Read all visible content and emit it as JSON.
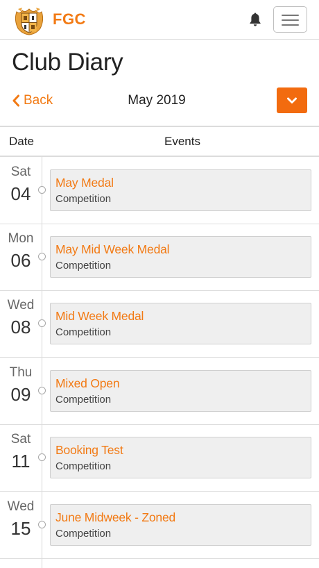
{
  "header": {
    "brand": "FGC",
    "crest_icon": "club-crest-icon",
    "bell_icon": "bell-icon",
    "menu_icon": "hamburger-menu-icon",
    "accent_color": "#f27a14"
  },
  "page": {
    "title": "Club Diary"
  },
  "controls": {
    "back_label": "Back",
    "month": "May 2019",
    "month_button_icon": "chevron-down-icon",
    "button_color": "#f26b0f"
  },
  "table": {
    "date_header": "Date",
    "events_header": "Events"
  },
  "events": [
    {
      "day": "Sat",
      "date": "04",
      "title": "May Medal",
      "type": "Competition"
    },
    {
      "day": "Mon",
      "date": "06",
      "title": "May Mid Week Medal",
      "type": "Competition"
    },
    {
      "day": "Wed",
      "date": "08",
      "title": "Mid Week Medal",
      "type": "Competition"
    },
    {
      "day": "Thu",
      "date": "09",
      "title": "Mixed Open",
      "type": "Competition"
    },
    {
      "day": "Sat",
      "date": "11",
      "title": "Booking Test",
      "type": "Competition"
    },
    {
      "day": "Wed",
      "date": "15",
      "title": "June Midweek - Zoned",
      "type": "Competition"
    }
  ]
}
